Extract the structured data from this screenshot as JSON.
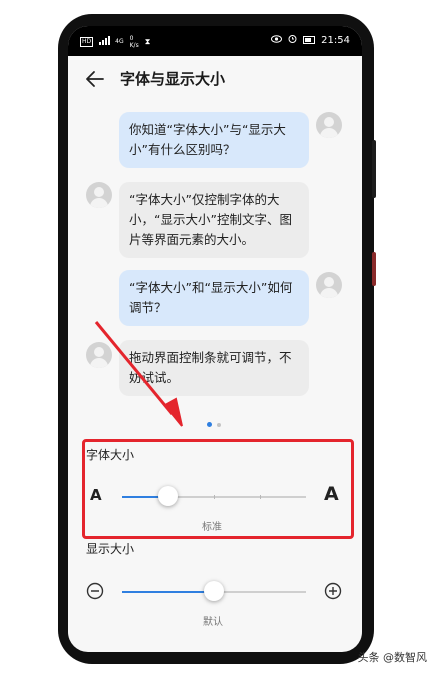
{
  "status_bar": {
    "network_left": "HD",
    "signal": "4G",
    "speed_value": "0",
    "speed_unit": "K/s",
    "time": "21:54"
  },
  "title_bar": {
    "title": "字体与显示大小"
  },
  "chat": [
    {
      "side": "right",
      "text": "你知道“字体大小”与“显示大小”有什么区别吗？"
    },
    {
      "side": "left",
      "text": "“字体大小”仅控制字体的大小，“显示大小”控制文字、图片等界面元素的大小。"
    },
    {
      "side": "right",
      "text": "“字体大小”和“显示大小”如何调节？"
    },
    {
      "side": "left",
      "text": "拖动界面控制条就可调节，不妨试试。"
    }
  ],
  "pager": {
    "count": 2,
    "active_index": 0
  },
  "font_size": {
    "label": "字体大小",
    "small_glyph": "A",
    "large_glyph": "A",
    "caption": "标准",
    "level": 0.25,
    "steps": 5
  },
  "display_size": {
    "label": "显示大小",
    "caption": "默认",
    "level": 0.5
  },
  "colors": {
    "accent": "#2f7fe0",
    "highlight": "#e4252d",
    "bubble_right": "#d8e8fb",
    "bubble_left": "#ececec"
  },
  "watermark": "头条 @数智风"
}
